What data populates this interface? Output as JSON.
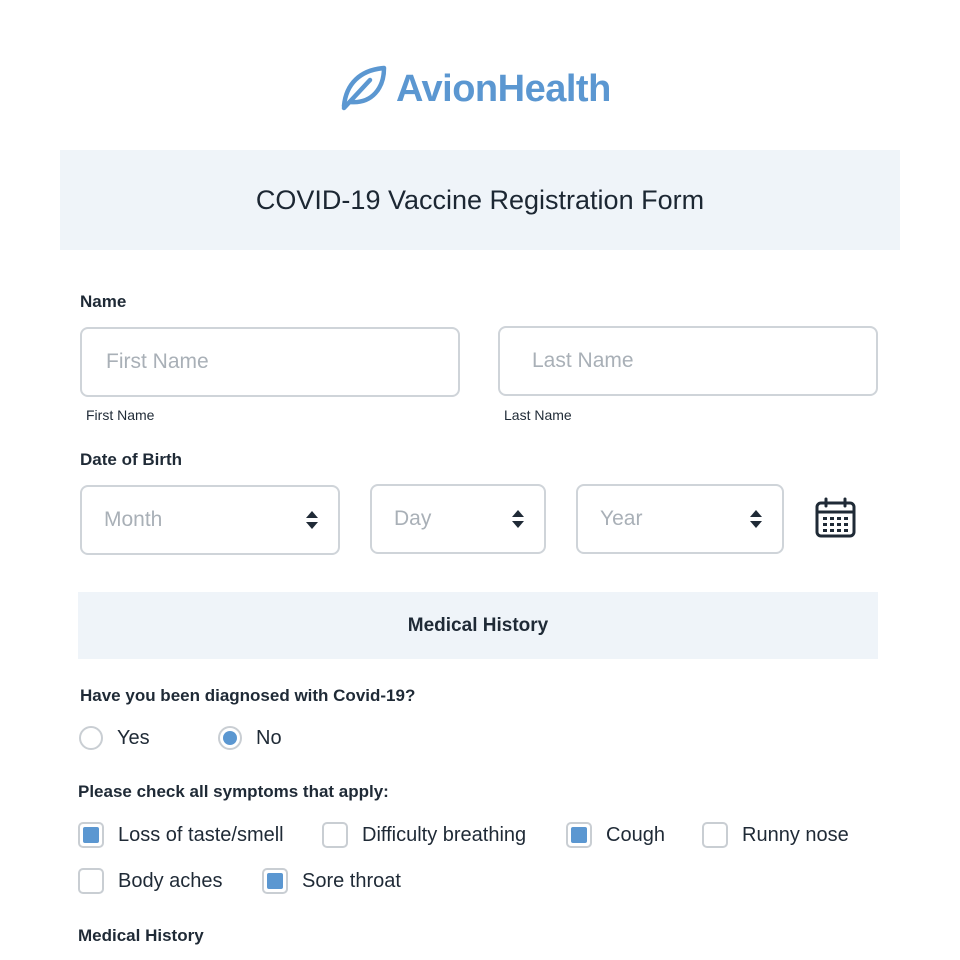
{
  "brand": {
    "name": "AvionHealth",
    "color": "#5b97d1",
    "logo_icon": "leaf-icon"
  },
  "form": {
    "title": "COVID-19 Vaccine Registration Form"
  },
  "name_section": {
    "label": "Name",
    "first": {
      "placeholder": "First Name",
      "sublabel": "First Name",
      "value": ""
    },
    "last": {
      "placeholder": "Last Name",
      "sublabel": "Last Name",
      "value": ""
    }
  },
  "dob": {
    "label": "Date of Birth",
    "month_placeholder": "Month",
    "day_placeholder": "Day",
    "year_placeholder": "Year",
    "calendar_icon": "calendar-icon"
  },
  "medical": {
    "section_title": "Medical History",
    "diagnosed_question": "Have you been diagnosed with Covid-19?",
    "diagnosed_options": [
      {
        "label": "Yes",
        "selected": false
      },
      {
        "label": "No",
        "selected": true
      }
    ],
    "symptoms_question": "Please check all symptoms that apply:",
    "symptoms": [
      {
        "label": "Loss of taste/smell",
        "checked": true
      },
      {
        "label": "Difficulty breathing",
        "checked": false
      },
      {
        "label": "Cough",
        "checked": true
      },
      {
        "label": "Runny nose",
        "checked": false
      },
      {
        "label": "Body aches",
        "checked": false
      },
      {
        "label": "Sore throat",
        "checked": true
      }
    ],
    "history_label": "Medical History"
  },
  "colors": {
    "accent": "#5b97d1",
    "band": "#eff4f9",
    "border": "#cfd4d9",
    "text": "#1f2a36"
  }
}
